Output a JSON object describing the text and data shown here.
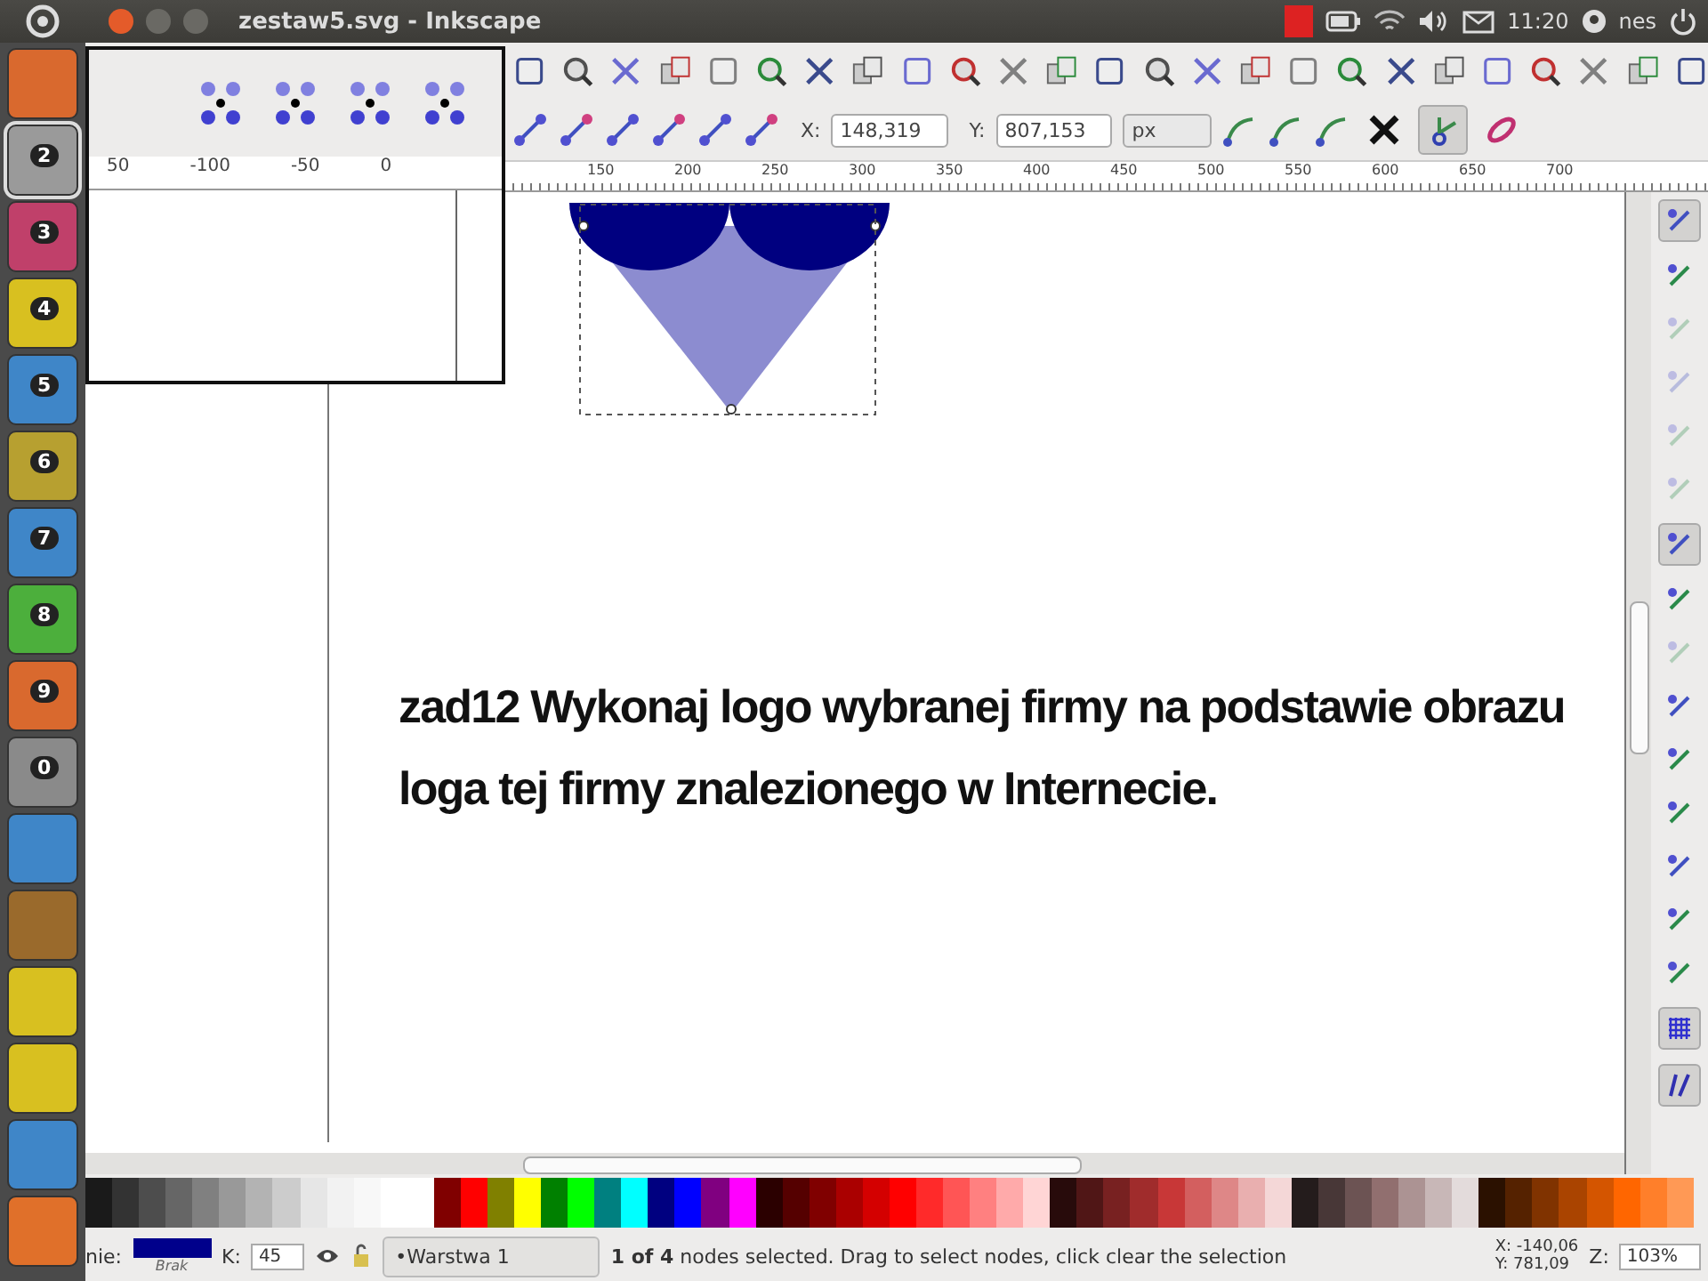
{
  "topbar": {
    "title": "zestaw5.svg - Inkscape",
    "time": "11:20",
    "user": "nes"
  },
  "launcher": [
    {
      "kind": "orange",
      "selected": false
    },
    {
      "kind": "inkscape",
      "badge": "2",
      "selected": true
    },
    {
      "kind": "pink",
      "badge": "3",
      "selected": false
    },
    {
      "kind": "yellow",
      "badge": "4",
      "selected": false
    },
    {
      "kind": "blue",
      "badge": "5",
      "selected": false
    },
    {
      "kind": "olive",
      "badge": "6",
      "selected": false
    },
    {
      "kind": "blue",
      "badge": "7",
      "selected": false
    },
    {
      "kind": "green",
      "badge": "8",
      "selected": false
    },
    {
      "kind": "orange",
      "badge": "9",
      "selected": false
    },
    {
      "kind": "grey",
      "badge": "0",
      "selected": false
    },
    {
      "kind": "blue",
      "selected": false
    },
    {
      "kind": "brown",
      "selected": false
    },
    {
      "kind": "yellow",
      "selected": false
    },
    {
      "kind": "yellow",
      "selected": false
    },
    {
      "kind": "blue",
      "selected": false
    },
    {
      "kind": "firefox",
      "selected": false
    }
  ],
  "magnifier": {
    "ruler_labels": [
      "50",
      "-100",
      "-50",
      "0"
    ]
  },
  "node_toolbar": {
    "x_label": "X:",
    "x_value": "148,319",
    "y_label": "Y:",
    "y_value": "807,153",
    "unit": "px",
    "toggles": [
      {
        "selected": false
      },
      {
        "selected": true
      },
      {
        "selected": false
      }
    ]
  },
  "ruler_labels": [
    "150",
    "200",
    "250",
    "300",
    "350",
    "400",
    "450",
    "500",
    "550",
    "600",
    "650",
    "700"
  ],
  "canvas": {
    "lines": [
      "zad12 Wykonaj logo wybranej firmy na podstawie obrazu",
      "loga tej firmy znalezionego w Internecie."
    ]
  },
  "snap_bar": [
    {
      "on": true,
      "disabled": false
    },
    {
      "on": false,
      "disabled": false
    },
    {
      "on": false,
      "disabled": true
    },
    {
      "on": false,
      "disabled": true
    },
    {
      "on": false,
      "disabled": true
    },
    {
      "on": false,
      "disabled": true
    },
    {
      "on": true,
      "disabled": false
    },
    {
      "on": false,
      "disabled": false
    },
    {
      "on": false,
      "disabled": true
    },
    {
      "on": false,
      "disabled": false
    },
    {
      "on": false,
      "disabled": false
    },
    {
      "on": false,
      "disabled": false
    },
    {
      "on": false,
      "disabled": false
    },
    {
      "on": false,
      "disabled": false
    },
    {
      "on": false,
      "disabled": false
    },
    {
      "on": true,
      "disabled": false
    },
    {
      "on": true,
      "disabled": false
    }
  ],
  "palette": [
    {
      "color": "#1a1a1a"
    },
    {
      "color": "#333333"
    },
    {
      "color": "#4d4d4d"
    },
    {
      "color": "#666666"
    },
    {
      "color": "#808080"
    },
    {
      "color": "#999999"
    },
    {
      "color": "#b3b3b3"
    },
    {
      "color": "#cccccc"
    },
    {
      "color": "#e6e6e6"
    },
    {
      "color": "#f2f2f2"
    },
    {
      "color": "#f8f8f8"
    },
    {
      "color": "#ffffff"
    },
    {
      "color": "#ffffff"
    },
    {
      "color": "#800000"
    },
    {
      "color": "#ff0000"
    },
    {
      "color": "#808000"
    },
    {
      "color": "#ffff00"
    },
    {
      "color": "#008000"
    },
    {
      "color": "#00ff00"
    },
    {
      "color": "#008080"
    },
    {
      "color": "#00ffff"
    },
    {
      "color": "#000080"
    },
    {
      "color": "#0000ff"
    },
    {
      "color": "#800080"
    },
    {
      "color": "#ff00ff"
    },
    {
      "color": "#2b0000"
    },
    {
      "color": "#550000"
    },
    {
      "color": "#800000"
    },
    {
      "color": "#aa0000"
    },
    {
      "color": "#d40000"
    },
    {
      "color": "#ff0000"
    },
    {
      "color": "#ff2a2a"
    },
    {
      "color": "#ff5555"
    },
    {
      "color": "#ff8080"
    },
    {
      "color": "#ffaaaa"
    },
    {
      "color": "#ffd5d5"
    },
    {
      "color": "#280b0b"
    },
    {
      "color": "#501616"
    },
    {
      "color": "#782121"
    },
    {
      "color": "#a02c2c"
    },
    {
      "color": "#c83737"
    },
    {
      "color": "#d35f5f"
    },
    {
      "color": "#de8787"
    },
    {
      "color": "#e9afaf"
    },
    {
      "color": "#f4d7d7"
    },
    {
      "color": "#241c1c"
    },
    {
      "color": "#483737"
    },
    {
      "color": "#6c5353"
    },
    {
      "color": "#916f6f"
    },
    {
      "color": "#ac9393"
    },
    {
      "color": "#c8b7b7"
    },
    {
      "color": "#e3dbdb"
    },
    {
      "color": "#2b1100"
    },
    {
      "color": "#552200"
    },
    {
      "color": "#803300"
    },
    {
      "color": "#aa4400"
    },
    {
      "color": "#d45500"
    },
    {
      "color": "#ff6600"
    },
    {
      "color": "#ff7f2a"
    },
    {
      "color": "#ff9955"
    }
  ],
  "status": {
    "fill_label": "nie:",
    "fill_swatches": [
      {
        "color": "#00008b"
      }
    ],
    "stroke_label": "Brak",
    "opacity_label": "K:",
    "opacity_value": "45",
    "layer": "•Warstwa 1",
    "message": "**1 of 4** nodes selected. Drag to select nodes, click clear the selection",
    "cursor_x": "X: -140,06",
    "cursor_y": "Y: 781,09",
    "zoom_label": "Z:",
    "zoom_value": "103%"
  }
}
